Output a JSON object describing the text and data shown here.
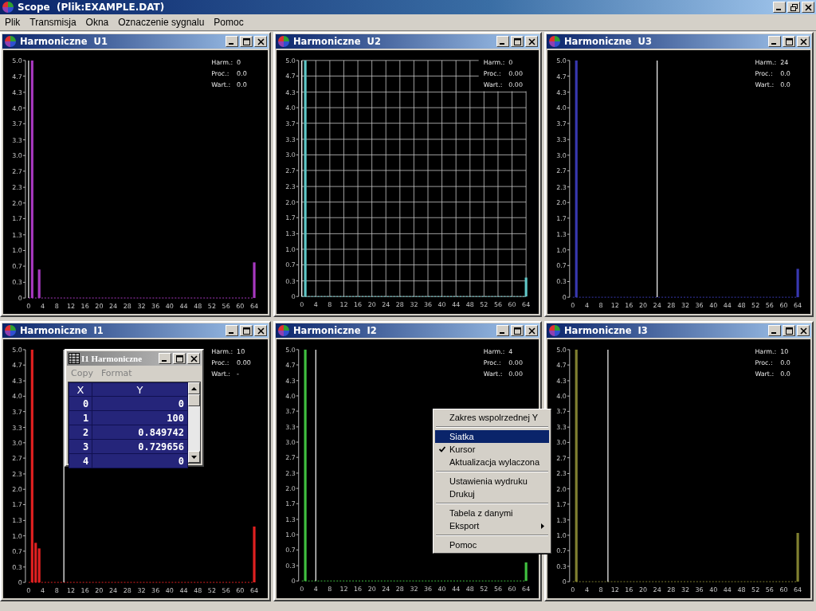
{
  "window": {
    "title": "Scope  (Plik:EXAMPLE.DAT)"
  },
  "menu": [
    "Plik",
    "Transmisja",
    "Okna",
    "Oznaczenie sygnalu",
    "Pomoc"
  ],
  "panels": [
    {
      "title": "Harmoniczne  U1",
      "readout": [
        {
          "label": "Harm.:",
          "value": "0"
        },
        {
          "label": "Proc.:",
          "value": "0.0"
        },
        {
          "label": "Wart.:",
          "value": "0.0"
        }
      ],
      "chart_data": {
        "type": "bar",
        "grid": false,
        "x": [
          1,
          3,
          64
        ],
        "series": [
          {
            "color": "#a838c0",
            "values": [
              5,
              0.6,
              0.75
            ]
          }
        ],
        "xlim": [
          0,
          64
        ],
        "ylim": [
          0,
          5
        ],
        "xticks": [
          0,
          4,
          8,
          12,
          16,
          20,
          24,
          28,
          32,
          36,
          40,
          44,
          48,
          52,
          56,
          60,
          64
        ],
        "yticks": [
          {
            "value": 0,
            "label": "0"
          },
          {
            "value": 0.33,
            "label": "0.3"
          },
          {
            "value": 0.67,
            "label": "0.7"
          },
          {
            "value": 1,
            "label": "1.0"
          },
          {
            "value": 1.33,
            "label": "1.3"
          },
          {
            "value": 1.67,
            "label": "1.7"
          },
          {
            "value": 2,
            "label": "2.0"
          },
          {
            "value": 2.33,
            "label": "2.3"
          },
          {
            "value": 2.67,
            "label": "2.7"
          },
          {
            "value": 3,
            "label": "3.0"
          },
          {
            "value": 3.33,
            "label": "3.3"
          },
          {
            "value": 3.67,
            "label": "3.7"
          },
          {
            "value": 4,
            "label": "4.0"
          },
          {
            "value": 4.33,
            "label": "4.3"
          },
          {
            "value": 4.67,
            "label": "4.7"
          },
          {
            "value": 5,
            "label": "5.0"
          }
        ],
        "ref_lines": [
          {
            "axis": "x",
            "value": 0
          }
        ]
      }
    },
    {
      "title": "Harmoniczne  U2",
      "readout": [
        {
          "label": "Harm.:",
          "value": "0"
        },
        {
          "label": "Proc.:",
          "value": "0.00"
        },
        {
          "label": "Wart.:",
          "value": "0.00"
        }
      ],
      "chart_data": {
        "type": "bar",
        "grid": true,
        "x": [
          1,
          64
        ],
        "series": [
          {
            "color": "#60c8c8",
            "values": [
              5,
              0.4
            ]
          }
        ],
        "xlim": [
          0,
          64
        ],
        "ylim": [
          0,
          5
        ],
        "xticks": [
          0,
          4,
          8,
          12,
          16,
          20,
          24,
          28,
          32,
          36,
          40,
          44,
          48,
          52,
          56,
          60,
          64
        ],
        "yticks": [
          {
            "value": 0,
            "label": "0"
          },
          {
            "value": 0.33,
            "label": "0.3"
          },
          {
            "value": 0.67,
            "label": "0.7"
          },
          {
            "value": 1,
            "label": "1.0"
          },
          {
            "value": 1.33,
            "label": "1.3"
          },
          {
            "value": 1.67,
            "label": "1.7"
          },
          {
            "value": 2,
            "label": "2.0"
          },
          {
            "value": 2.33,
            "label": "2.3"
          },
          {
            "value": 2.67,
            "label": "2.7"
          },
          {
            "value": 3,
            "label": "3.0"
          },
          {
            "value": 3.33,
            "label": "3.3"
          },
          {
            "value": 3.67,
            "label": "3.7"
          },
          {
            "value": 4,
            "label": "4.0"
          },
          {
            "value": 4.33,
            "label": "4.3"
          },
          {
            "value": 4.67,
            "label": "4.7"
          },
          {
            "value": 5,
            "label": "5.0"
          }
        ],
        "ref_lines": [
          {
            "axis": "x",
            "value": 0
          }
        ]
      }
    },
    {
      "title": "Harmoniczne  U3",
      "readout": [
        {
          "label": "Harm.:",
          "value": "24"
        },
        {
          "label": "Proc.:",
          "value": "0.0"
        },
        {
          "label": "Wart.:",
          "value": "0.0"
        }
      ],
      "chart_data": {
        "type": "bar",
        "grid": false,
        "x": [
          1,
          64
        ],
        "series": [
          {
            "color": "#3838b0",
            "values": [
              5,
              0.6
            ]
          }
        ],
        "xlim": [
          0,
          64
        ],
        "ylim": [
          0,
          5
        ],
        "xticks": [
          0,
          4,
          8,
          12,
          16,
          20,
          24,
          28,
          32,
          36,
          40,
          44,
          48,
          52,
          56,
          60,
          64
        ],
        "yticks": [
          {
            "value": 0,
            "label": "0"
          },
          {
            "value": 0.33,
            "label": "0.3"
          },
          {
            "value": 0.67,
            "label": "0.7"
          },
          {
            "value": 1,
            "label": "1.0"
          },
          {
            "value": 1.33,
            "label": "1.3"
          },
          {
            "value": 1.67,
            "label": "1.7"
          },
          {
            "value": 2,
            "label": "2.0"
          },
          {
            "value": 2.33,
            "label": "2.3"
          },
          {
            "value": 2.67,
            "label": "2.7"
          },
          {
            "value": 3,
            "label": "3.0"
          },
          {
            "value": 3.33,
            "label": "3.3"
          },
          {
            "value": 3.67,
            "label": "3.7"
          },
          {
            "value": 4,
            "label": "4.0"
          },
          {
            "value": 4.33,
            "label": "4.3"
          },
          {
            "value": 4.67,
            "label": "4.7"
          },
          {
            "value": 5,
            "label": "5.0"
          }
        ],
        "ref_lines": [
          {
            "axis": "x",
            "value": 24
          }
        ]
      }
    },
    {
      "title": "Harmoniczne  I1",
      "readout": [
        {
          "label": "Harm.:",
          "value": "10"
        },
        {
          "label": "Proc.:",
          "value": "0.00"
        },
        {
          "label": "Wart.:",
          "value": "-"
        }
      ],
      "chart_data": {
        "type": "bar",
        "grid": false,
        "x": [
          1,
          2,
          3,
          64
        ],
        "series": [
          {
            "color": "#e02020",
            "values": [
              5,
              0.85,
              0.73,
              1.2
            ]
          }
        ],
        "xlim": [
          0,
          64
        ],
        "ylim": [
          0,
          5
        ],
        "xticks": [
          0,
          4,
          8,
          12,
          16,
          20,
          24,
          28,
          32,
          36,
          40,
          44,
          48,
          52,
          56,
          60,
          64
        ],
        "yticks": [
          {
            "value": 0,
            "label": "0"
          },
          {
            "value": 0.33,
            "label": "0.3"
          },
          {
            "value": 0.67,
            "label": "0.7"
          },
          {
            "value": 1,
            "label": "1.0"
          },
          {
            "value": 1.33,
            "label": "1.3"
          },
          {
            "value": 1.67,
            "label": "1.7"
          },
          {
            "value": 2,
            "label": "2.0"
          },
          {
            "value": 2.33,
            "label": "2.3"
          },
          {
            "value": 2.67,
            "label": "2.7"
          },
          {
            "value": 3,
            "label": "3.0"
          },
          {
            "value": 3.33,
            "label": "3.3"
          },
          {
            "value": 3.67,
            "label": "3.7"
          },
          {
            "value": 4,
            "label": "4.0"
          },
          {
            "value": 4.33,
            "label": "4.3"
          },
          {
            "value": 4.67,
            "label": "4.7"
          },
          {
            "value": 5,
            "label": "5.0"
          }
        ],
        "ref_lines": [
          {
            "axis": "x",
            "value": 10
          }
        ]
      }
    },
    {
      "title": "Harmoniczne  I2",
      "readout": [
        {
          "label": "Harm.:",
          "value": "4"
        },
        {
          "label": "Proc.:",
          "value": "0.00"
        },
        {
          "label": "Wart.:",
          "value": "0.00"
        }
      ],
      "chart_data": {
        "type": "bar",
        "grid": false,
        "x": [
          1,
          64
        ],
        "series": [
          {
            "color": "#40c040",
            "values": [
              5,
              0.4
            ]
          }
        ],
        "xlim": [
          0,
          64
        ],
        "ylim": [
          0,
          5
        ],
        "xticks": [
          0,
          4,
          8,
          12,
          16,
          20,
          24,
          28,
          32,
          36,
          40,
          44,
          48,
          52,
          56,
          60,
          64
        ],
        "yticks": [
          {
            "value": 0,
            "label": "0"
          },
          {
            "value": 0.33,
            "label": "0.3"
          },
          {
            "value": 0.67,
            "label": "0.7"
          },
          {
            "value": 1,
            "label": "1.0"
          },
          {
            "value": 1.33,
            "label": "1.3"
          },
          {
            "value": 1.67,
            "label": "1.7"
          },
          {
            "value": 2,
            "label": "2.0"
          },
          {
            "value": 2.33,
            "label": "2.3"
          },
          {
            "value": 2.67,
            "label": "2.7"
          },
          {
            "value": 3,
            "label": "3.0"
          },
          {
            "value": 3.33,
            "label": "3.3"
          },
          {
            "value": 3.67,
            "label": "3.7"
          },
          {
            "value": 4,
            "label": "4.0"
          },
          {
            "value": 4.33,
            "label": "4.3"
          },
          {
            "value": 4.67,
            "label": "4.7"
          },
          {
            "value": 5,
            "label": "5.0"
          }
        ],
        "ref_lines": [
          {
            "axis": "x",
            "value": 4
          }
        ]
      }
    },
    {
      "title": "Harmoniczne  I3",
      "readout": [
        {
          "label": "Harm.:",
          "value": "10"
        },
        {
          "label": "Proc.:",
          "value": "0.0"
        },
        {
          "label": "Wart.:",
          "value": "0.0"
        }
      ],
      "chart_data": {
        "type": "bar",
        "grid": false,
        "x": [
          1,
          64
        ],
        "series": [
          {
            "color": "#808030",
            "values": [
              5,
              1.05
            ]
          }
        ],
        "xlim": [
          0,
          64
        ],
        "ylim": [
          0,
          5
        ],
        "xticks": [
          0,
          4,
          8,
          12,
          16,
          20,
          24,
          28,
          32,
          36,
          40,
          44,
          48,
          52,
          56,
          60,
          64
        ],
        "yticks": [
          {
            "value": 0,
            "label": "0"
          },
          {
            "value": 0.33,
            "label": "0.3"
          },
          {
            "value": 0.67,
            "label": "0.7"
          },
          {
            "value": 1,
            "label": "1.0"
          },
          {
            "value": 1.33,
            "label": "1.3"
          },
          {
            "value": 1.67,
            "label": "1.7"
          },
          {
            "value": 2,
            "label": "2.0"
          },
          {
            "value": 2.33,
            "label": "2.3"
          },
          {
            "value": 2.67,
            "label": "2.7"
          },
          {
            "value": 3,
            "label": "3.0"
          },
          {
            "value": 3.33,
            "label": "3.3"
          },
          {
            "value": 3.67,
            "label": "3.7"
          },
          {
            "value": 4,
            "label": "4.0"
          },
          {
            "value": 4.33,
            "label": "4.3"
          },
          {
            "value": 4.67,
            "label": "4.7"
          },
          {
            "value": 5,
            "label": "5.0"
          }
        ],
        "ref_lines": [
          {
            "axis": "x",
            "value": 10
          }
        ]
      }
    }
  ],
  "data_window": {
    "title": "I1 Harmoniczne",
    "menu": [
      {
        "label": "Copy",
        "disabled": true
      },
      {
        "label": "Format",
        "disabled": true
      }
    ],
    "columns": [
      "X",
      "Y"
    ],
    "rows": [
      [
        "0",
        "0"
      ],
      [
        "1",
        "100"
      ],
      [
        "2",
        "0.849742"
      ],
      [
        "3",
        "0.729656"
      ],
      [
        "4",
        "0"
      ]
    ]
  },
  "context_menu": {
    "items": [
      {
        "kind": "item",
        "label": "Zakres wspolrzednej Y",
        "selected": false,
        "checked": false,
        "submenu": false
      },
      {
        "kind": "separator"
      },
      {
        "kind": "item",
        "label": "Siatka",
        "selected": true,
        "checked": false,
        "submenu": false
      },
      {
        "kind": "item",
        "label": "Kursor",
        "selected": false,
        "checked": true,
        "submenu": false
      },
      {
        "kind": "item",
        "label": "Aktualizacja wylaczona",
        "selected": false,
        "checked": false,
        "submenu": false
      },
      {
        "kind": "separator"
      },
      {
        "kind": "item",
        "label": "Ustawienia wydruku",
        "selected": false,
        "checked": false,
        "submenu": false
      },
      {
        "kind": "item",
        "label": "Drukuj",
        "selected": false,
        "checked": false,
        "submenu": false
      },
      {
        "kind": "separator"
      },
      {
        "kind": "item",
        "label": "Tabela z danymi",
        "selected": false,
        "checked": false,
        "submenu": false
      },
      {
        "kind": "item",
        "label": "Eksport",
        "selected": false,
        "checked": false,
        "submenu": true
      },
      {
        "kind": "separator"
      },
      {
        "kind": "item",
        "label": "Pomoc",
        "selected": false,
        "checked": false,
        "submenu": false
      }
    ]
  }
}
